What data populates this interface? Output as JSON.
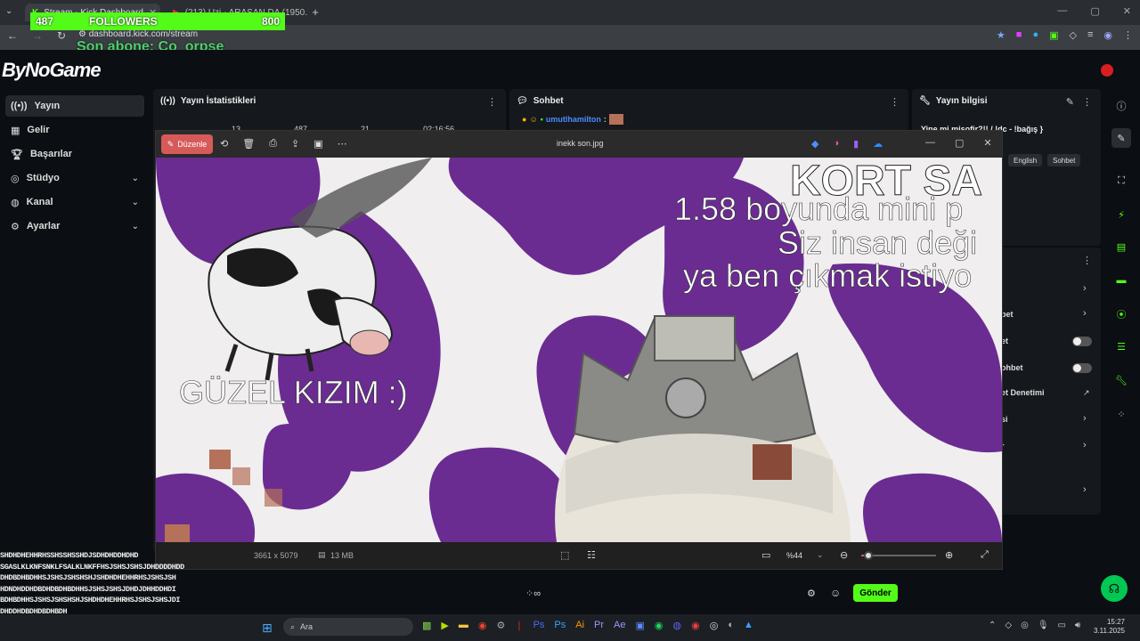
{
  "browser": {
    "tabs": [
      {
        "label": "Stream - Kick Dashboard",
        "active": true
      },
      {
        "label": "(213) Uzi - ARASAN DA (1950...",
        "active": false
      }
    ],
    "url": "dashboard.kick.com/stream"
  },
  "overlay": {
    "count1": "487",
    "followers_label": "FOLLOWERS",
    "count2": "800",
    "last_sub": "Son abone: Co_orpse"
  },
  "kick": {
    "logo": "ByNoGame",
    "sidebar": [
      {
        "label": "Yayın",
        "active": true,
        "expand": false
      },
      {
        "label": "Gelir",
        "active": false,
        "expand": false
      },
      {
        "label": "Başarılar",
        "active": false,
        "expand": false
      },
      {
        "label": "Stüdyo",
        "active": false,
        "expand": true
      },
      {
        "label": "Kanal",
        "active": false,
        "expand": true
      },
      {
        "label": "Ayarlar",
        "active": false,
        "expand": true
      }
    ],
    "panels": {
      "stats": "Yayın İstatistikleri",
      "stats_values": [
        "13",
        "487",
        "21",
        "02:16:56"
      ],
      "chat": "Sohbet",
      "chat_user": "umutlhamilton",
      "info": "Yayın bilgisi",
      "info_title": "Yine mi misofir?!! / !dc - !bağış }",
      "chips": [
        "English",
        "Sohbet"
      ],
      "right_list": [
        "bet",
        "et",
        "ohbet",
        "et Denetimi",
        "si",
        "r"
      ]
    },
    "send_label": "Gönder"
  },
  "viewer": {
    "edit_label": "Düzenle",
    "file_name": "inekk son.jpg",
    "image_text": {
      "top": "KORT SA",
      "line1": "1.58 boyunda mini p",
      "line2": "Siz insan deği",
      "line3": "ya ben çıkmak istiyo",
      "caption": "GÜZEL KIZIM :)"
    },
    "dimensions": "3661 x 5079",
    "file_size": "13 MB",
    "zoom": "%44"
  },
  "spam": [
    "SHDHDHEHHRHSSHSSHSSHDJSDHDHDDHDHD",
    "SGASLKLKNFSNKLFSALKLNKFFHSJSHSJSHSJDHDDDDHDD",
    "DHDBDHBDHHSJSHSJSHSHSHJSHDHDHEHHRHSJSHSJSH",
    "HDNDHDDHDBDHDBDHBDHHSJSHSJSHSJDHDJDHHDDHDI",
    "BDHBDHHSJSHSJSHSHSHJSHDHDHEHHRHSJSHSJSHSJDI",
    "DHDDHDBDHDBDHBDH"
  ],
  "spam_user": "umutlhamilton",
  "taskbar": {
    "search": "Ara",
    "time": "15:27",
    "date": "3.11.2025"
  },
  "colors": {
    "kick_green": "#53fc18",
    "purple": "#6a2c91",
    "edit_red": "#d65a5a"
  }
}
